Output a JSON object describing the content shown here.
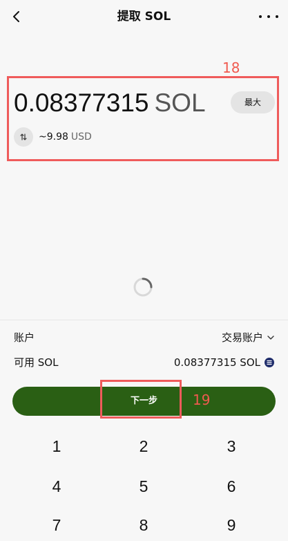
{
  "header": {
    "title": "提取 SOL"
  },
  "annotations": {
    "amount_label": "18",
    "next_label": "19"
  },
  "amount": {
    "value": "0.08377315",
    "unit": "SOL",
    "max_label": "最大"
  },
  "conversion": {
    "value": "~9.98",
    "currency": "USD"
  },
  "account": {
    "label": "账户",
    "value": "交易账户"
  },
  "available": {
    "label": "可用 SOL",
    "value": "0.08377315 SOL"
  },
  "actions": {
    "next_label": "下一步"
  },
  "keypad": {
    "keys": [
      "1",
      "2",
      "3",
      "4",
      "5",
      "6",
      "7",
      "8",
      "9"
    ]
  },
  "colors": {
    "primary_button": "#2a5f14",
    "annotation": "#ef5b5b",
    "sol_badge": "#1f2d6b"
  }
}
